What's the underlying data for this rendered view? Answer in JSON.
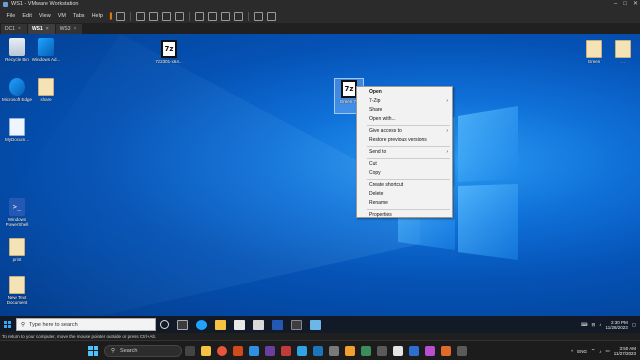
{
  "window": {
    "title": "WS1 - VMware Workstation",
    "controls": [
      "–",
      "□",
      "✕"
    ]
  },
  "menubar": {
    "items": [
      "File",
      "Edit",
      "View",
      "VM",
      "Tabs",
      "Help"
    ]
  },
  "vm_tabs": [
    {
      "label": "DC1",
      "active": false
    },
    {
      "label": "WS1",
      "active": true
    },
    {
      "label": "WS3",
      "active": false
    }
  ],
  "desktop": {
    "icons": [
      {
        "id": "recycle-bin",
        "label": "Recycle Bin",
        "kind": "bin"
      },
      {
        "id": "windows-admin",
        "label": "Windows Ad...",
        "kind": "blue"
      },
      {
        "id": "edge",
        "label": "Microsoft Edge",
        "kind": "blue"
      },
      {
        "id": "share",
        "label": "share",
        "kind": "file"
      },
      {
        "id": "mydocs",
        "label": "MyDocum...",
        "kind": "doc"
      },
      {
        "id": "powershell",
        "label": "Windows PowerShell",
        "kind": "ps"
      },
      {
        "id": "print",
        "label": "print",
        "kind": "file"
      },
      {
        "id": "newtext",
        "label": "New Text Document",
        "kind": "doc"
      },
      {
        "id": "sevenzip-top",
        "label": "7z2301-x64...",
        "kind": "7z"
      },
      {
        "id": "green-sel",
        "label": "Green.7z",
        "kind": "7z"
      },
      {
        "id": "green-right",
        "label": "Green",
        "kind": "file"
      },
      {
        "id": "green-right2",
        "label": "...",
        "kind": "file"
      }
    ]
  },
  "context_menu": {
    "items": [
      {
        "label": "Open",
        "bold": true,
        "submenu": false
      },
      {
        "label": "7-Zip",
        "bold": false,
        "submenu": true
      },
      {
        "label": "Share",
        "bold": false,
        "submenu": false
      },
      {
        "label": "Open with...",
        "bold": false,
        "submenu": false
      },
      {
        "sep": true
      },
      {
        "label": "Give access to",
        "bold": false,
        "submenu": true
      },
      {
        "label": "Restore previous versions",
        "bold": false,
        "submenu": false
      },
      {
        "sep": true
      },
      {
        "label": "Send to",
        "bold": false,
        "submenu": true
      },
      {
        "sep": true
      },
      {
        "label": "Cut",
        "bold": false,
        "submenu": false
      },
      {
        "label": "Copy",
        "bold": false,
        "submenu": false
      },
      {
        "sep": true
      },
      {
        "label": "Create shortcut",
        "bold": false,
        "submenu": false
      },
      {
        "label": "Delete",
        "bold": false,
        "submenu": false
      },
      {
        "label": "Rename",
        "bold": false,
        "submenu": false
      },
      {
        "sep": true
      },
      {
        "label": "Properties",
        "bold": false,
        "submenu": false
      }
    ]
  },
  "guest_taskbar": {
    "search_placeholder": "Type here to search",
    "clock_time": "2:30 PM",
    "clock_date": "11/28/2023"
  },
  "status_bar": {
    "text": "To return to your computer, move the mouse pointer outside or press Ctrl+Alt."
  },
  "host_taskbar": {
    "search_label": "Search",
    "language": "ENG",
    "clock_time": "3:50 AM",
    "clock_date": "11/27/2023"
  },
  "colors": {
    "desktop_accent": "#0f70d8",
    "pause_button": "#ff8a00"
  }
}
